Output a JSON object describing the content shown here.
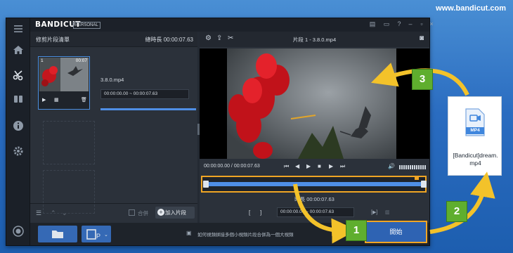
{
  "site": "www.bandicut.com",
  "app": {
    "brand": "BANDICUT",
    "edition": "PERSONAL"
  },
  "left_panel": {
    "title": "修剪片段清單",
    "total_label": "總時長 00:00:07.63",
    "clip": {
      "index": "1",
      "duration": "00:07",
      "name": "3.8.0.mp4",
      "start": "00:00:00.00",
      "sep": "~",
      "end": "00:00:07.63"
    },
    "merge_label": "合併",
    "add_button": "加入片段"
  },
  "right_panel": {
    "title": "片段 1 - 3.8.0.mp4",
    "timecode": "00:00:00.00 / 00:00:07.63",
    "duration_label": "時長 00:00:07.63",
    "range_start": "00:00:00.00",
    "range_sep": "~",
    "range_end": "00:00:07.63",
    "volume_level": 1.0
  },
  "bottom": {
    "hint": "如何視頻拼接多個小視頻片段合併為一個大視頻",
    "start_button": "開始"
  },
  "steps": [
    "1",
    "2",
    "3"
  ],
  "output_file": {
    "type": "MP4",
    "name": "[Bandicut]dream.mp4"
  },
  "colors": {
    "accent": "#4f8fe6",
    "highlight": "#f0a524",
    "step": "#5fae2e",
    "arrow": "#f3c22a"
  }
}
